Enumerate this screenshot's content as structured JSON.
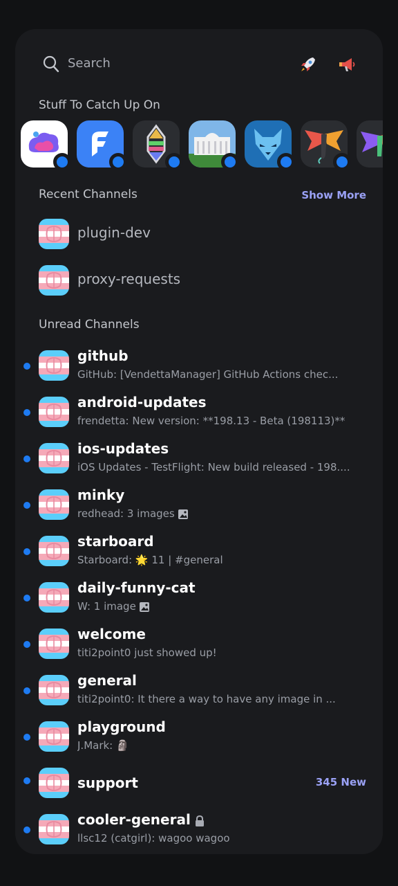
{
  "search": {
    "label": "Search"
  },
  "sections": {
    "catch_up": "Stuff To Catch Up On",
    "recent": "Recent Channels",
    "show_more": "Show More",
    "unread": "Unread Channels"
  },
  "servers": [
    {
      "icon": "blob-logo-icon",
      "bg": "#ffffff"
    },
    {
      "icon": "flame-logo-icon",
      "bg": "#3b82f6"
    },
    {
      "icon": "crystal-logo-icon",
      "bg": "#2b2d31"
    },
    {
      "icon": "white-house-icon",
      "bg": "#7fb6e8"
    },
    {
      "icon": "wolf-logo-icon",
      "bg": "#1f6fb5"
    },
    {
      "icon": "dragon-logo-icon",
      "bg": "#2b2d31"
    },
    {
      "icon": "rainbow-dragon-icon",
      "bg": "#2b2d31"
    }
  ],
  "recent_channels": [
    {
      "name": "plugin-dev"
    },
    {
      "name": "proxy-requests"
    }
  ],
  "unread_channels": [
    {
      "name": "github",
      "preview": "GitHub: [VendettaManager] GitHub Actions chec..."
    },
    {
      "name": "android-updates",
      "preview": "frendetta: New version: **198.13 - Beta (198113)**"
    },
    {
      "name": "ios-updates",
      "preview": "iOS Updates - TestFlight: New build released - 198...."
    },
    {
      "name": "minky",
      "preview": "redhead: 3 images"
    },
    {
      "name": "starboard",
      "preview_pre": "Starboard: ",
      "preview_emoji": "🌟",
      "preview_post": " 11 | #general"
    },
    {
      "name": "daily-funny-cat",
      "preview": "W: 1 image"
    },
    {
      "name": "welcome",
      "preview": "titi2point0 just showed up!"
    },
    {
      "name": "general",
      "preview": "titi2point0: It there a way to have any image in ..."
    },
    {
      "name": "playground",
      "preview": "J.Mark: 🗿"
    },
    {
      "name": "support",
      "badge": "345 New"
    },
    {
      "name": "cooler-general",
      "preview": "llsc12 (catgirl): wagoo wagoo"
    }
  ],
  "colors": {
    "accent": "#9aa1f5",
    "unread_dot": "#1e7bf2",
    "panel": "#1a1b1e"
  }
}
